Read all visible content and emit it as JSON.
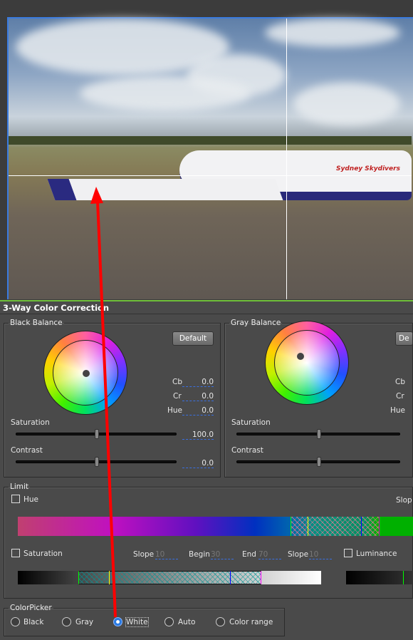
{
  "panel_title": "3-Way Color Correction",
  "black_balance": {
    "legend": "Black Balance",
    "default_label": "Default",
    "cb_label": "Cb",
    "cb": "0.0",
    "cr_label": "Cr",
    "cr": "0.0",
    "hue_label": "Hue",
    "hue": "0.0",
    "saturation_label": "Saturation",
    "saturation": "100.0",
    "contrast_label": "Contrast",
    "contrast": "0.0"
  },
  "gray_balance": {
    "legend": "Gray Balance",
    "default_label": "De",
    "cb_label": "Cb",
    "cr_label": "Cr",
    "hue_label": "Hue",
    "saturation_label": "Saturation",
    "contrast_label": "Contrast"
  },
  "limit": {
    "legend": "Limit",
    "hue_label": "Hue",
    "slope_cut": "Slop",
    "saturation_label": "Saturation",
    "slope1_label": "Slope",
    "slope1": "10",
    "begin_label": "Begin",
    "begin": "30",
    "end_label": "End",
    "end": "70",
    "slope2_label": "Slope",
    "slope2": "10",
    "luminance_label": "Luminance"
  },
  "color_picker": {
    "legend": "ColorPicker",
    "options": [
      "Black",
      "Gray",
      "White",
      "Auto",
      "Color range"
    ],
    "selected": "White"
  },
  "photo": {
    "plane_text": "Sydney Skydivers"
  },
  "colors": {
    "accent": "#2a7ae2",
    "arrow": "#ff0000",
    "border_green": "#6fc03a"
  }
}
